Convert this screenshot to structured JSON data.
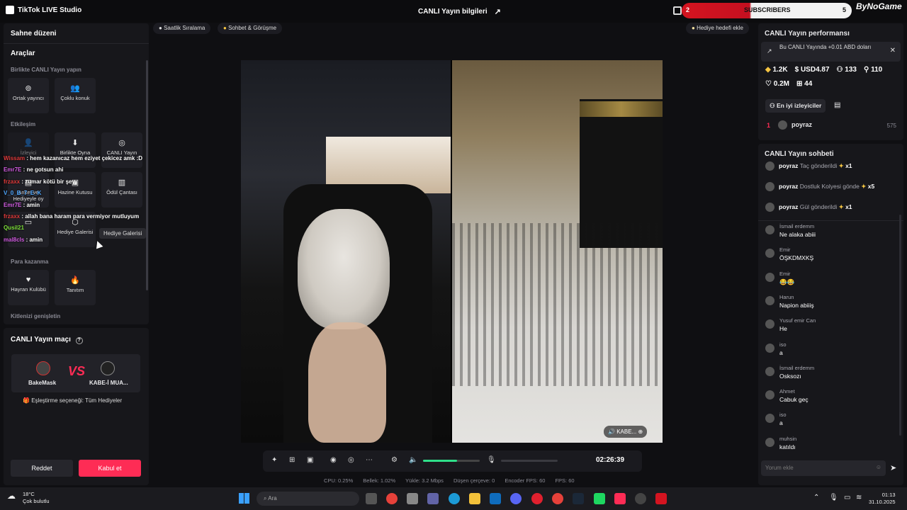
{
  "titlebar": {
    "app_name": "TikTok LIVE Studio",
    "center_title": "CANLI Yayın bilgileri",
    "subscribers_left": "2",
    "subscribers_label": "SUBSCRIBERS",
    "subscribers_right": "5",
    "brand": "ByNoGame"
  },
  "left": {
    "title": "Sahne düzeni",
    "tools_title": "Araçlar",
    "section_live": "Birlikte CANLI Yayın yapın",
    "tile_cohost": "Ortak yayıncı",
    "tile_multi": "Çoklu konuk",
    "section_interaction": "Etkileşim",
    "tile_viewer": "İzleyici",
    "tile_gift": "Birlikte Oyna",
    "tile_live_goal": "CANLI Yayın",
    "tile_poll": "Anket ve Hediyeyle oy",
    "tile_treasure": "Hazine Kutusu",
    "tile_reward_bag": "Ödül Çantası",
    "tile_gift_gallery": "Hediye Galerisi",
    "tooltip": "Hediye Galerisi",
    "section_earn": "Para kazanma",
    "tile_fan_club": "Hayran Kulübü",
    "tile_promo": "Tanıtım",
    "section_expand": "Kitlenizi genişletin"
  },
  "pk": {
    "title": "CANLI Yayın maçı",
    "player1": "BakeMask",
    "vs": "VS",
    "player2": "KABE-İ MUA...",
    "match_option": "Eşleştirme seçeneği: Tüm Hediyeler",
    "decline": "Reddet",
    "accept": "Kabul et"
  },
  "chips": {
    "hourly_rank": "Saatlik Sıralama",
    "chat_meet": "Sohbet & Görüşme",
    "gift_goal": "Hediye hedefi ekle"
  },
  "overlay_chat": [
    {
      "user": "Wissam",
      "text": "hem kazanıcaz hem eziyet çekicez amk :D",
      "color": "#e03a3a"
    },
    {
      "user": "Emr7E",
      "text": "ne gotsun ahi",
      "color": "#d05be0"
    },
    {
      "user": "frzaxx",
      "text": "zumar kötü bir şey",
      "color": "#e03a3a"
    },
    {
      "user": "V_0_B_7_E_K",
      "text": "",
      "color": "#4ea7ff"
    },
    {
      "user": "Emr7E",
      "text": "amin",
      "color": "#d05be0"
    },
    {
      "user": "frzaxx",
      "text": "allah bana haram para vermiyor mutluyum",
      "color": "#e03a3a"
    },
    {
      "user": "Qusil21",
      "text": "",
      "color": "#7ee03a"
    },
    {
      "user": "mal8cls",
      "text": "amin",
      "color": "#d05be0"
    }
  ],
  "video": {
    "label": "KABE..."
  },
  "controls": {
    "volume_level": 0.6,
    "timer": "02:26:39"
  },
  "stats": {
    "cpu": "CPU: 0.25%",
    "memory": "Bellek: 1.02%",
    "upload": "Yükle: 3.2 Mbps",
    "dropped": "Düşen çerçeve: 0",
    "encoder_fps": "Encoder FPS: 60",
    "fps": "FPS: 60"
  },
  "performance": {
    "title": "CANLI Yayın performansı",
    "notice": "Bu CANLI Yayında +0.01 ABD doları",
    "diamonds": "1.2K",
    "usd": "USD4.87",
    "viewers": "133",
    "new_followers": "110",
    "likes": "0.2M",
    "gifters": "44",
    "top_viewers_label": "En iyi izleyiciler",
    "top1_rank": "1",
    "top1_name": "poyraz",
    "top1_score": "575"
  },
  "chat": {
    "title": "CANLI Yayın sohbeti",
    "gift_events": [
      {
        "user": "poyraz",
        "text": "Taç gönderildi",
        "count": "x1"
      },
      {
        "user": "poyraz",
        "text": "Dostluk Kolyesi gönde",
        "count": "x5"
      },
      {
        "user": "poyraz",
        "text": "Gül gönderildi",
        "count": "x1"
      }
    ],
    "messages": [
      {
        "user": "İsmail erdemm",
        "text": "Ne alaka abiii"
      },
      {
        "user": "Emir",
        "text": "ÖŞKDMXKŞ"
      },
      {
        "user": "Emir",
        "text": "😂😂"
      },
      {
        "user": "Harun",
        "text": "Napion abiiiş"
      },
      {
        "user": "Yusuf emir Can",
        "text": "He"
      },
      {
        "user": "iso",
        "text": "a"
      },
      {
        "user": "İsmail erdemm",
        "text": "Osksozı"
      },
      {
        "user": "Ahmet",
        "text": "Cabuk geç"
      },
      {
        "user": "iso",
        "text": "a"
      },
      {
        "user": "muhsin",
        "text": "katıldı"
      }
    ],
    "input_placeholder": "Yorum ekle"
  },
  "taskbar": {
    "temp": "18°C",
    "weather": "Çok bulutlu",
    "search_placeholder": "Ara",
    "time": "01:13",
    "date": "31.10.2025"
  }
}
